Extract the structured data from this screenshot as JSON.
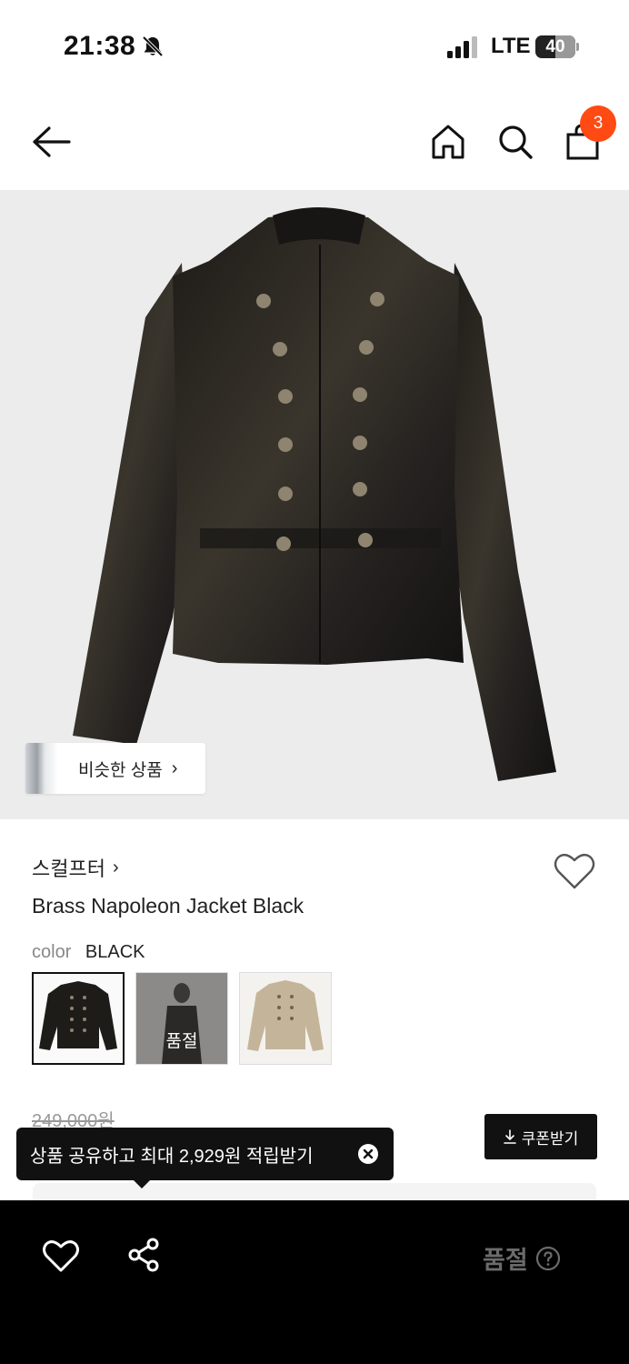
{
  "status_bar": {
    "time": "21:38",
    "network": "LTE",
    "battery": "40"
  },
  "header": {
    "cart_count": "3",
    "icons": [
      "back-arrow-icon",
      "home-icon",
      "search-icon",
      "shopping-bag-icon"
    ]
  },
  "product": {
    "similar_label": "비슷한 상품",
    "brand": "스컬프터",
    "name": "Brass Napoleon Jacket Black",
    "color_label": "color",
    "color_value": "BLACK",
    "swatches": [
      {
        "name": "black",
        "soldout": ""
      },
      {
        "name": "model",
        "soldout": "품절"
      },
      {
        "name": "beige",
        "soldout": ""
      }
    ],
    "original_price": "249,000원",
    "coupon_label": "쿠폰받기"
  },
  "toast": {
    "text": "상품 공유하고 최대 2,929원 적립받기"
  },
  "bottom_bar": {
    "status": "품절"
  },
  "colors": {
    "accent": "#ff4a14",
    "black": "#111111",
    "image_bg": "#ececed"
  }
}
